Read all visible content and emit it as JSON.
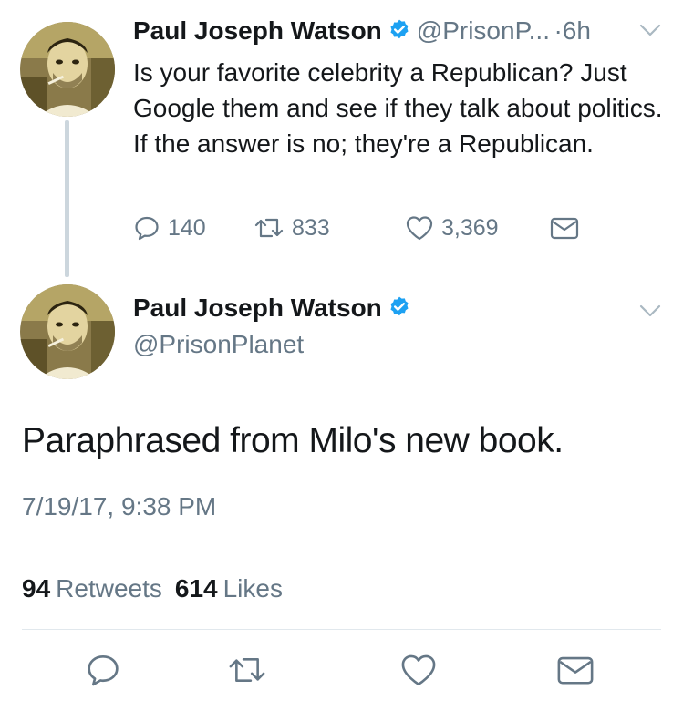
{
  "colors": {
    "primary_text": "#14171a",
    "secondary_text": "#657786",
    "verified_blue": "#1da1f2",
    "divider": "#e1e8ed",
    "thread_line": "#ccd6dd"
  },
  "tweet1": {
    "author_name": "Paul Joseph Watson",
    "handle_truncated": "@PrisonP...",
    "separator": "·",
    "time_ago": "6h",
    "text": "Is your favorite celebrity a Republican? Just Google them and see if they talk about politics. If the answer is no; they're a Republican.",
    "replies": "140",
    "retweets": "833",
    "likes": "3,369"
  },
  "tweet2": {
    "author_name": "Paul Joseph Watson",
    "handle": "@PrisonPlanet",
    "text": "Paraphrased from Milo's new book.",
    "timestamp": "7/19/17, 9:38 PM",
    "retweet_count": "94",
    "retweet_label": "Retweets",
    "like_count": "614",
    "like_label": "Likes"
  },
  "icons": {
    "verified": "verified-badge-icon",
    "chevron": "chevron-down-icon",
    "reply": "reply-icon",
    "retweet": "retweet-icon",
    "like": "heart-icon",
    "message": "envelope-icon"
  }
}
